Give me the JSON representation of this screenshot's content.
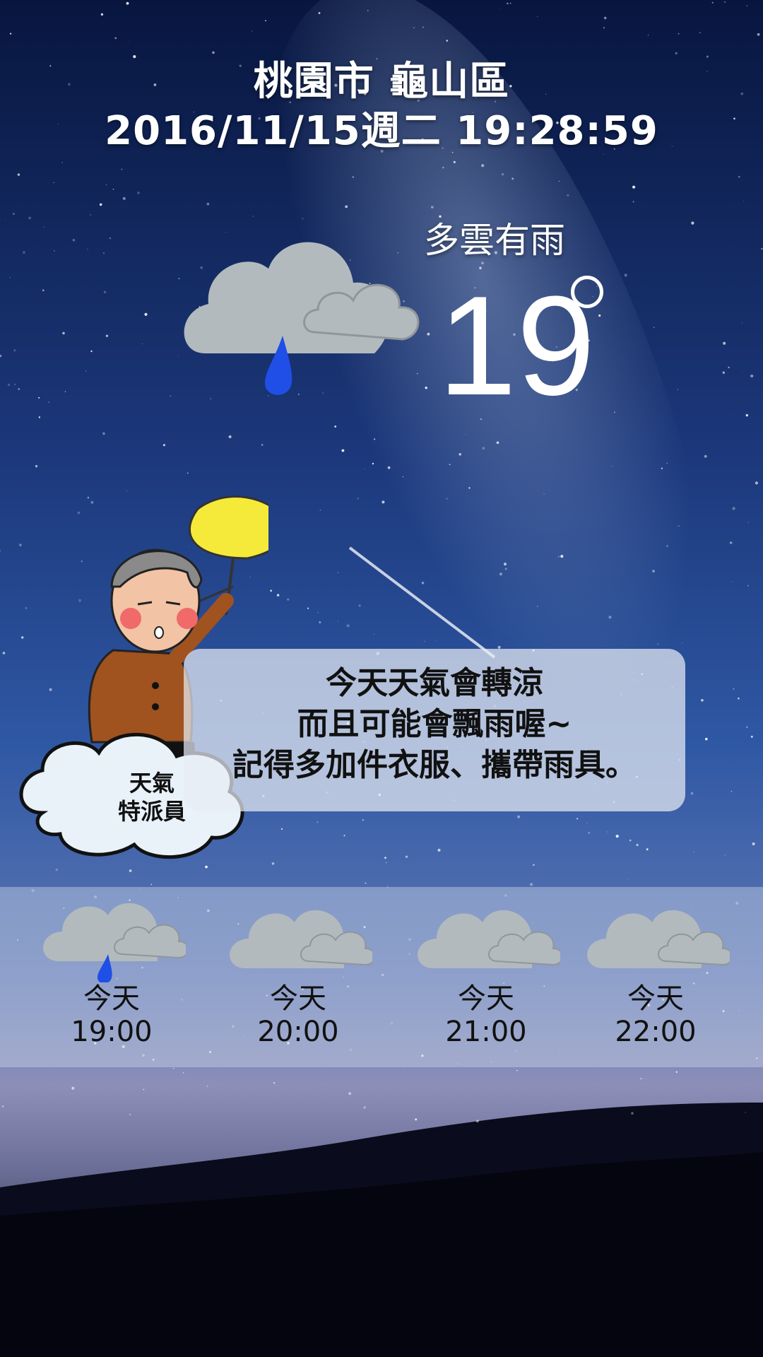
{
  "header": {
    "location": "桃園市 龜山區",
    "datetime": "2016/11/15週二 19:28:59"
  },
  "current": {
    "condition": "多雲有雨",
    "temperature": "19",
    "icon": "cloud-rain-icon"
  },
  "mascot": {
    "cloud_label_line1": "天氣",
    "cloud_label_line2": "特派員"
  },
  "message": {
    "line1": "今天天氣會轉涼",
    "line2": "而且可能會飄雨喔~",
    "line3": "記得多加件衣服、攜帶雨具。"
  },
  "forecast": [
    {
      "day": "今天",
      "time": "19:00",
      "icon": "cloud-rain-icon"
    },
    {
      "day": "今天",
      "time": "20:00",
      "icon": "cloud-icon"
    },
    {
      "day": "今天",
      "time": "21:00",
      "icon": "cloud-icon"
    },
    {
      "day": "今天",
      "time": "22:00",
      "icon": "cloud-icon"
    }
  ],
  "colors": {
    "sky_top": "#0b1a4a",
    "sky_mid": "#2a4a8c",
    "cloud": "#b5bcc0",
    "raindrop": "#1a4be0",
    "umbrella": "#f5ea3a"
  }
}
